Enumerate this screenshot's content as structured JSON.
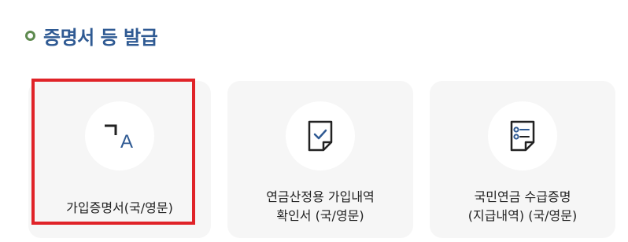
{
  "section": {
    "title": "증명서 등 발급"
  },
  "cards": [
    {
      "label": "가입증명서(국/영문)",
      "icon": "translate-icon",
      "selected": true
    },
    {
      "label": "연금산정용 가입내역\n확인서 (국/영문)",
      "icon": "document-check-icon",
      "selected": false
    },
    {
      "label": "국민연금 수급증명\n(지급내역) (국/영문)",
      "icon": "document-list-icon",
      "selected": false
    }
  ],
  "colors": {
    "title": "#2f5a93",
    "bullet": "#5e8a4f",
    "highlight": "#e02328",
    "card_bg": "#f6f6f6",
    "icon_accent": "#2f5a93"
  }
}
